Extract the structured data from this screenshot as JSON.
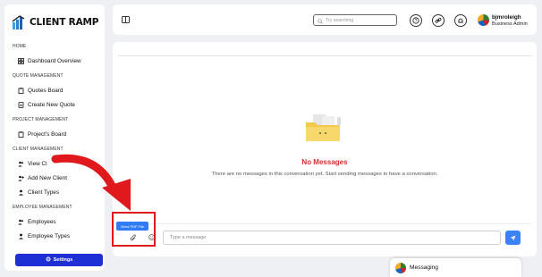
{
  "brand": {
    "name": "CLIENT RAMP"
  },
  "sidebar": {
    "sections": [
      {
        "label": "HOME",
        "items": [
          {
            "label": "Dashboard Overview",
            "icon": "dashboard-icon"
          }
        ]
      },
      {
        "label": "QUOTE MANAGEMENT",
        "items": [
          {
            "label": "Quotes Board",
            "icon": "clipboard-icon"
          },
          {
            "label": "Create New Quote",
            "icon": "document-icon"
          }
        ]
      },
      {
        "label": "PROJECT MANAGEMENT",
        "items": [
          {
            "label": "Project's Board",
            "icon": "clipboard-icon"
          }
        ]
      },
      {
        "label": "CLIENT MANAGEMENT",
        "items": [
          {
            "label": "View Cl",
            "icon": "users-icon"
          },
          {
            "label": "Add New Client",
            "icon": "user-plus-icon"
          },
          {
            "label": "Client Types",
            "icon": "user-icon"
          }
        ]
      },
      {
        "label": "EMPLOYEE MANAGEMENT",
        "items": [
          {
            "label": "Employees",
            "icon": "users-icon"
          },
          {
            "label": "Employee Types",
            "icon": "user-icon"
          }
        ]
      }
    ],
    "settings_label": "Settings"
  },
  "header": {
    "search_placeholder": "Try searching",
    "user_name": "bjmroleigh",
    "user_role": "Business Admin"
  },
  "main": {
    "empty_title": "No Messages",
    "empty_subtitle": "There are no messages in this conversation yet. Start sending messages to have a conversation.",
    "send_pdf_label": "Send PDF File",
    "message_placeholder": "Type a message"
  },
  "messaging": {
    "label": "Messaging"
  },
  "colors": {
    "accent": "#1f2fd6",
    "danger": "#d32f2f",
    "send": "#3b82f6",
    "highlight": "#e0191c"
  }
}
